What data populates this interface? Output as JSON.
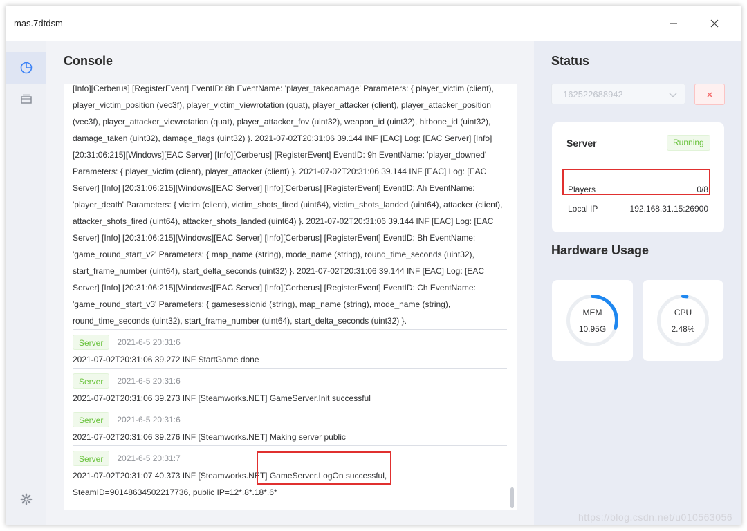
{
  "window": {
    "title": "mas.7dtdsm"
  },
  "sidebar": {
    "items": [
      {
        "name": "dashboard",
        "icon": "pie-chart-icon",
        "active": true
      },
      {
        "name": "servers",
        "icon": "stack-icon",
        "active": false
      }
    ],
    "settings_icon": "gear-icon"
  },
  "console": {
    "title": "Console",
    "first_entry_text": "[Info][Cerberus] [RegisterEvent] EventID: 8h EventName: 'player_takedamage' Parameters: { player_victim (client), player_victim_position (vec3f), player_victim_viewrotation (quat), player_attacker (client), player_attacker_position (vec3f), player_attacker_viewrotation (quat), player_attacker_fov (uint32), weapon_id (uint32), hitbone_id (uint32), damage_taken (uint32), damage_flags (uint32) }. 2021-07-02T20:31:06 39.144 INF [EAC] Log: [EAC Server] [Info] [20:31:06:215][Windows][EAC Server] [Info][Cerberus] [RegisterEvent] EventID: 9h EventName: 'player_downed' Parameters: { player_victim (client), player_attacker (client) }. 2021-07-02T20:31:06 39.144 INF [EAC] Log: [EAC Server] [Info] [20:31:06:215][Windows][EAC Server] [Info][Cerberus] [RegisterEvent] EventID: Ah EventName: 'player_death' Parameters: { victim (client), victim_shots_fired (uint64), victim_shots_landed (uint64), attacker (client), attacker_shots_fired (uint64), attacker_shots_landed (uint64) }. 2021-07-02T20:31:06 39.144 INF [EAC] Log: [EAC Server] [Info] [20:31:06:215][Windows][EAC Server] [Info][Cerberus] [RegisterEvent] EventID: Bh EventName: 'game_round_start_v2' Parameters: { map_name (string), mode_name (string), round_time_seconds (uint32), start_frame_number (uint64), start_delta_seconds (uint32) }. 2021-07-02T20:31:06 39.144 INF [EAC] Log: [EAC Server] [Info] [20:31:06:215][Windows][EAC Server] [Info][Cerberus] [RegisterEvent] EventID: Ch EventName: 'game_round_start_v3' Parameters: { gamesessionid (string), map_name (string), mode_name (string), round_time_seconds (uint32), start_frame_number (uint64), start_delta_seconds (uint32) }.",
    "entries": [
      {
        "source": "Server",
        "time": "2021-6-5 20:31:6",
        "text": "2021-07-02T20:31:06 39.272 INF StartGame done"
      },
      {
        "source": "Server",
        "time": "2021-6-5 20:31:6",
        "text": "2021-07-02T20:31:06 39.273 INF [Steamworks.NET] GameServer.Init successful"
      },
      {
        "source": "Server",
        "time": "2021-6-5 20:31:6",
        "text": "2021-07-02T20:31:06 39.276 INF [Steamworks.NET] Making server public"
      },
      {
        "source": "Server",
        "time": "2021-6-5 20:31:7",
        "text": "2021-07-02T20:31:07 40.373 INF [Steamworks.NET] GameServer.LogOn successful, SteamID=90148634502217736, public IP=12*.8*.18*.6*"
      }
    ]
  },
  "status": {
    "title": "Status",
    "server_select_value": "162522688942",
    "stop_icon": "close-icon",
    "server_card": {
      "title": "Server",
      "state": "Running",
      "players_label": "Players",
      "players_value": "0/8",
      "local_ip_label": "Local IP",
      "local_ip_value": "192.168.31.15:26900"
    }
  },
  "hardware": {
    "title": "Hardware Usage",
    "mem": {
      "label": "MEM",
      "value": "10.95G",
      "fraction": 0.3
    },
    "cpu": {
      "label": "CPU",
      "value": "2.48%",
      "fraction": 0.025
    },
    "accent": "#1e87f0",
    "track": "#ebeef2"
  },
  "watermark": "https://blog.csdn.net/u010563056"
}
